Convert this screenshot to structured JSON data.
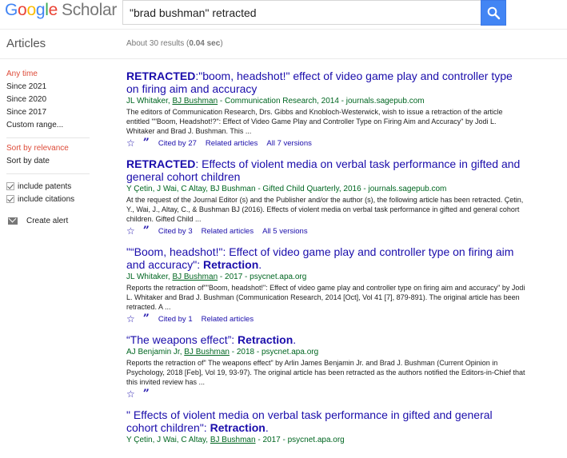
{
  "header": {
    "logo_text": "Google",
    "logo_sub": "Scholar",
    "search_value": "\"brad bushman\" retracted"
  },
  "toolbar": {
    "section_title": "Articles",
    "results_prefix": "About 30 results (",
    "results_time": "0.04 sec",
    "results_suffix": ")"
  },
  "sidebar": {
    "time_filters": [
      "Any time",
      "Since 2021",
      "Since 2020",
      "Since 2017",
      "Custom range..."
    ],
    "sort_options": [
      "Sort by relevance",
      "Sort by date"
    ],
    "checkboxes": [
      "include patents",
      "include citations"
    ],
    "create_alert": "Create alert"
  },
  "results": [
    {
      "tag": "RETRACTED",
      "title": ":\"boom, headshot!\" effect of video game play and controller type on firing aim and accuracy",
      "authors_pre": "JL Whitaker, ",
      "authors_link": "BJ Bushman",
      "authors_post": " - Communication Research, 2014 - journals.sagepub.com",
      "snippet": "The editors of Communication Research, Drs. Gibbs and Knobloch-Westerwick, wish to issue a retraction of the article entitled \"\"Boom, Headshot!?\": Effect of Video Game Play and Controller Type on Firing Aim and Accuracy\" by Jodi L. Whitaker and Brad J. Bushman. This ...",
      "cited": "Cited by 27",
      "related": "Related articles",
      "versions": "All 7 versions"
    },
    {
      "tag": "RETRACTED",
      "title": ": Effects of violent media on verbal task performance in gifted and general cohort children",
      "authors_pre": "Y Çetin, J Wai, C Altay, BJ Bushman",
      "authors_link": "",
      "authors_post": " - Gifted Child Quarterly, 2016 - journals.sagepub.com",
      "snippet": "At the request of the Journal Editor (s) and the Publisher and/or the author (s), the following article has been retracted. Çetin, Y., Wai, J., Altay, C., & Bushman BJ (2016). Effects of violent media on verbal task performance in gifted and general cohort children. Gifted Child ...",
      "cited": "Cited by 3",
      "related": "Related articles",
      "versions": "All 5 versions"
    },
    {
      "tag_prefix": "\"“Boom, headshot!\": Effect of video game play and controller type on firing aim and accuracy\": ",
      "tag": "Retraction",
      "title_suffix": ".",
      "authors_pre": "JL Whitaker, ",
      "authors_link": "BJ Bushman",
      "authors_post": " - 2017 - psycnet.apa.org",
      "snippet": "Reports the retraction of\"\"Boom, headshot!\": Effect of video game play and controller type on firing aim and accuracy\" by Jodi L. Whitaker and Brad J. Bushman (Communication Research, 2014 [Oct], Vol 41 [7], 879-891). The original article has been retracted. A ...",
      "cited": "Cited by 1",
      "related": "Related articles"
    },
    {
      "tag_prefix": "“The weapons effect”: ",
      "tag": "Retraction",
      "title_suffix": ".",
      "authors_pre": "AJ Benjamin Jr, ",
      "authors_link": "BJ Bushman",
      "authors_post": " - 2018 - psycnet.apa.org",
      "snippet": "Reports the retraction of\" The weapons effect\" by Arlin James Benjamin Jr. and Brad J. Bushman (Current Opinion in Psychology, 2018 [Feb], Vol 19, 93-97). The original article has been retracted as the authors notified the Editors-in-Chief that this invited review has ..."
    },
    {
      "tag_prefix": "\" Effects of violent media on verbal task performance in gifted and general cohort children\": ",
      "tag": "Retraction",
      "title_suffix": ".",
      "authors_pre": "Y Çetin, J Wai, C Altay, ",
      "authors_link": "BJ Bushman",
      "authors_post": " - 2017 - psycnet.apa.org"
    }
  ]
}
